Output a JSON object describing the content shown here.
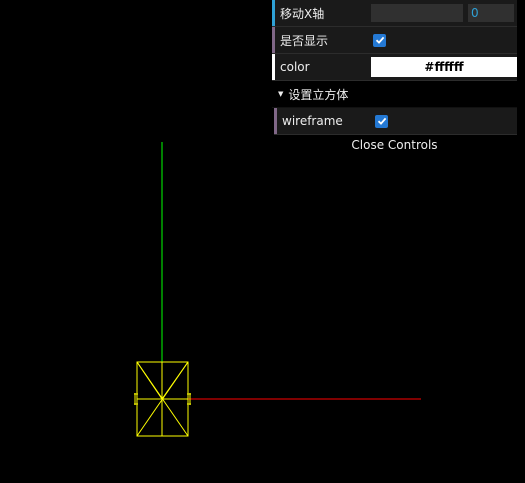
{
  "scene": {
    "wireframe_color": "#ffff00",
    "y_axis_color": "#00ff00",
    "x_axis_color": "#ff0000",
    "background": "#000000"
  },
  "gui": {
    "move_x": {
      "label": "移动X轴",
      "value": "0",
      "accent": "#2fa1d6"
    },
    "show": {
      "label": "是否显示",
      "checked": true,
      "accent": "#806787"
    },
    "color": {
      "label": "color",
      "value": "#ffffff",
      "accent": "#ffffff"
    },
    "folder": {
      "title": "设置立方体",
      "wireframe": {
        "label": "wireframe",
        "checked": true,
        "accent": "#806787"
      }
    },
    "close_label": "Close Controls"
  }
}
